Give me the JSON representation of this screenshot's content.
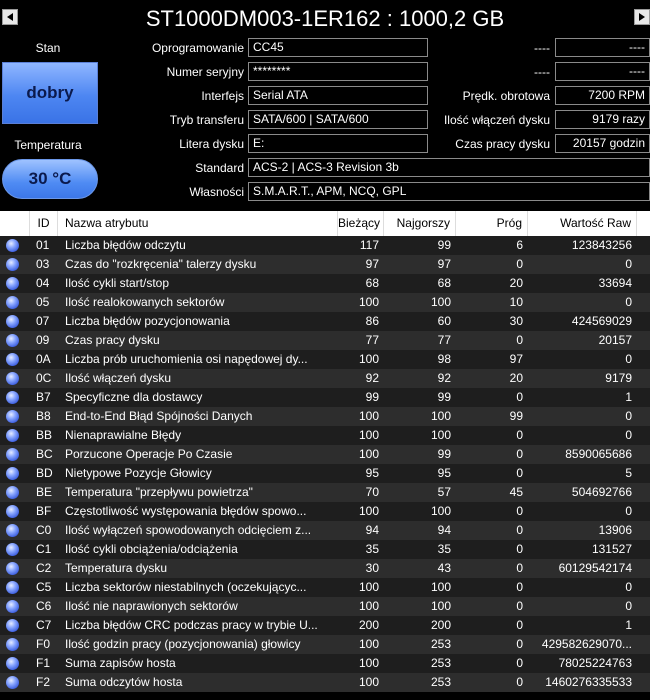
{
  "title": "ST1000DM003-1ER162 : 1000,2 GB",
  "status": {
    "health_label": "Stan",
    "health_value": "dobry",
    "temp_label": "Temperatura",
    "temp_value": "30 °C"
  },
  "info": {
    "firmware_label": "Oprogramowanie",
    "firmware": "CC45",
    "serial_label": "Numer seryjny",
    "serial": "********",
    "interface_label": "Interfejs",
    "interface": "Serial ATA",
    "transfer_label": "Tryb transferu",
    "transfer": "SATA/600 | SATA/600",
    "letter_label": "Litera dysku",
    "letter": "E:",
    "standard_label": "Standard",
    "standard": "ACS-2 | ACS-3 Revision 3b",
    "features_label": "Własności",
    "features": "S.M.A.R.T., APM, NCQ, GPL",
    "r1_label": "----",
    "r1_value": "----",
    "r2_label": "----",
    "r2_value": "----",
    "rpm_label": "Prędk. obrotowa",
    "rpm": "7200 RPM",
    "power_count_label": "Ilość włączeń dysku",
    "power_count": "9179 razy",
    "power_hours_label": "Czas pracy dysku",
    "power_hours": "20157 godzin"
  },
  "table": {
    "headers": {
      "id": "ID",
      "name": "Nazwa atrybutu",
      "current": "Bieżący",
      "worst": "Najgorszy",
      "threshold": "Próg",
      "raw": "Wartość Raw"
    },
    "rows": [
      {
        "id": "01",
        "name": "Liczba błędów odczytu",
        "cur": "117",
        "worst": "99",
        "thr": "6",
        "raw": "123843256"
      },
      {
        "id": "03",
        "name": "Czas do \"rozkręcenia\" talerzy dysku",
        "cur": "97",
        "worst": "97",
        "thr": "0",
        "raw": "0"
      },
      {
        "id": "04",
        "name": "Ilość cykli start/stop",
        "cur": "68",
        "worst": "68",
        "thr": "20",
        "raw": "33694"
      },
      {
        "id": "05",
        "name": "Ilość realokowanych sektorów",
        "cur": "100",
        "worst": "100",
        "thr": "10",
        "raw": "0"
      },
      {
        "id": "07",
        "name": "Liczba błędów pozycjonowania",
        "cur": "86",
        "worst": "60",
        "thr": "30",
        "raw": "424569029"
      },
      {
        "id": "09",
        "name": "Czas pracy dysku",
        "cur": "77",
        "worst": "77",
        "thr": "0",
        "raw": "20157"
      },
      {
        "id": "0A",
        "name": "Liczba prób uruchomienia osi napędowej dy...",
        "cur": "100",
        "worst": "98",
        "thr": "97",
        "raw": "0"
      },
      {
        "id": "0C",
        "name": "Ilość włączeń dysku",
        "cur": "92",
        "worst": "92",
        "thr": "20",
        "raw": "9179"
      },
      {
        "id": "B7",
        "name": "Specyficzne dla dostawcy",
        "cur": "99",
        "worst": "99",
        "thr": "0",
        "raw": "1"
      },
      {
        "id": "B8",
        "name": "End-to-End Błąd Spójności Danych",
        "cur": "100",
        "worst": "100",
        "thr": "99",
        "raw": "0"
      },
      {
        "id": "BB",
        "name": "Nienaprawialne Błędy",
        "cur": "100",
        "worst": "100",
        "thr": "0",
        "raw": "0"
      },
      {
        "id": "BC",
        "name": "Porzucone Operacje Po Czasie",
        "cur": "100",
        "worst": "99",
        "thr": "0",
        "raw": "8590065686"
      },
      {
        "id": "BD",
        "name": "Nietypowe Pozycje Głowicy",
        "cur": "95",
        "worst": "95",
        "thr": "0",
        "raw": "5"
      },
      {
        "id": "BE",
        "name": "Temperatura \"przepływu powietrza\"",
        "cur": "70",
        "worst": "57",
        "thr": "45",
        "raw": "504692766"
      },
      {
        "id": "BF",
        "name": "Częstotliwość występowania błędów spowo...",
        "cur": "100",
        "worst": "100",
        "thr": "0",
        "raw": "0"
      },
      {
        "id": "C0",
        "name": "Ilość wyłączeń spowodowanych odcięciem z...",
        "cur": "94",
        "worst": "94",
        "thr": "0",
        "raw": "13906"
      },
      {
        "id": "C1",
        "name": "Ilość cykli obciążenia/odciążenia",
        "cur": "35",
        "worst": "35",
        "thr": "0",
        "raw": "131527"
      },
      {
        "id": "C2",
        "name": "Temperatura dysku",
        "cur": "30",
        "worst": "43",
        "thr": "0",
        "raw": "60129542174"
      },
      {
        "id": "C5",
        "name": "Liczba sektorów niestabilnych (oczekującyc...",
        "cur": "100",
        "worst": "100",
        "thr": "0",
        "raw": "0"
      },
      {
        "id": "C6",
        "name": "Ilość nie naprawionych sektorów",
        "cur": "100",
        "worst": "100",
        "thr": "0",
        "raw": "0"
      },
      {
        "id": "C7",
        "name": "Liczba błędów CRC podczas pracy w trybie U...",
        "cur": "200",
        "worst": "200",
        "thr": "0",
        "raw": "1"
      },
      {
        "id": "F0",
        "name": "Ilość godzin pracy (pozycjonowania) głowicy",
        "cur": "100",
        "worst": "253",
        "thr": "0",
        "raw": "429582629070..."
      },
      {
        "id": "F1",
        "name": "Suma zapisów hosta",
        "cur": "100",
        "worst": "253",
        "thr": "0",
        "raw": "78025224763"
      },
      {
        "id": "F2",
        "name": "Suma odczytów hosta",
        "cur": "100",
        "worst": "253",
        "thr": "0",
        "raw": "1460276335533"
      }
    ]
  }
}
